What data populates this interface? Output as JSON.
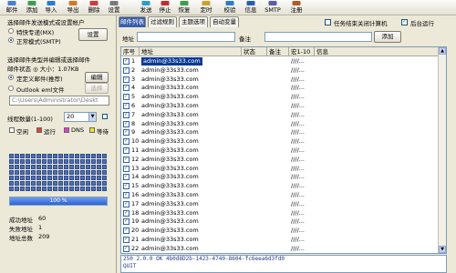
{
  "toolbar": {
    "buttons": [
      {
        "label": "邮件",
        "icon": "mail-icon"
      },
      {
        "label": "添加",
        "icon": "add-icon"
      },
      {
        "label": "导入",
        "icon": "import-icon"
      },
      {
        "label": "导出",
        "icon": "export-icon"
      },
      {
        "label": "删除",
        "icon": "delete-icon"
      },
      {
        "label": "设置",
        "icon": "settings-icon"
      },
      {
        "label": "发送",
        "icon": "send-icon"
      },
      {
        "label": "停止",
        "icon": "stop-icon"
      },
      {
        "label": "恢复",
        "icon": "resume-icon"
      },
      {
        "label": "定时",
        "icon": "timer-icon"
      },
      {
        "label": "校验",
        "icon": "verify-icon"
      },
      {
        "label": "信息",
        "icon": "info-icon"
      },
      {
        "label": "SMTP",
        "icon": "smtp-icon"
      },
      {
        "label": "注册",
        "icon": "register-icon"
      }
    ]
  },
  "left": {
    "send_mode_title": "选择邮件发送模式或设置帐户",
    "mode_special": "特快专递(MX)",
    "mode_smtp": "正常模式(SMTP)",
    "settings_btn": "设置",
    "mail_type_title": "选择邮件类型并编辑或选择邮件",
    "mail_status": "邮件状态 ◎ 大小：1.07KB",
    "type_custom": "定定义邮件(推荐)",
    "edit_btn": "编辑",
    "type_outlook": "Outlook eml文件",
    "choose_btn": "选择",
    "path_value": "C:\\Users\\Administrator\\Deskt",
    "threads_label": "线程数量(1-100)",
    "threads_value": "20",
    "legend": [
      {
        "label": "空闲",
        "color": "#ffffff"
      },
      {
        "label": "运行",
        "color": "#e0443a"
      },
      {
        "label": "DNS",
        "color": "#e040c8"
      },
      {
        "label": "等待",
        "color": "#f0e030"
      }
    ],
    "progress_text": "100 %",
    "progress_fraction": 1.0,
    "stats": {
      "success_label": "成功地址",
      "success_value": "60",
      "fail_label": "失败地址",
      "fail_value": "1",
      "total_label": "地址总数",
      "total_value": "209"
    }
  },
  "tabs": [
    "邮件列表",
    "过滤规则",
    "主题选项",
    "自动变量"
  ],
  "options": {
    "shutdown_label": "任务结束关闭计算机",
    "background_label": "后台运行"
  },
  "address_row": {
    "address_label": "地址",
    "remark_label": "备注",
    "add_btn": "添加"
  },
  "table": {
    "headers": [
      "序号",
      "地址",
      "状态",
      "备注",
      "宏1-10",
      "信息"
    ],
    "rows": [
      {
        "n": "1",
        "addr": "admin@33s33.com",
        "macro": "////..."
      },
      {
        "n": "2",
        "addr": "admin@33s33.com",
        "macro": "////..."
      },
      {
        "n": "3",
        "addr": "admin@33s33.com",
        "macro": "////..."
      },
      {
        "n": "4",
        "addr": "admin@33s33.com",
        "macro": "////..."
      },
      {
        "n": "5",
        "addr": "admin@33s33.com",
        "macro": "////..."
      },
      {
        "n": "6",
        "addr": "admin@33s33.com",
        "macro": "////..."
      },
      {
        "n": "7",
        "addr": "admin@33s33.com",
        "macro": "////..."
      },
      {
        "n": "8",
        "addr": "admin@33s33.com",
        "macro": "////..."
      },
      {
        "n": "9",
        "addr": "admin@33s33.com",
        "macro": "////..."
      },
      {
        "n": "10",
        "addr": "admin@33s33.com",
        "macro": "////..."
      },
      {
        "n": "11",
        "addr": "admin@33s33.com",
        "macro": "////..."
      },
      {
        "n": "12",
        "addr": "admin@33s33.com",
        "macro": "////..."
      },
      {
        "n": "13",
        "addr": "admin@33s33.com",
        "macro": "////..."
      },
      {
        "n": "14",
        "addr": "admin@33s33.com",
        "macro": "////..."
      },
      {
        "n": "15",
        "addr": "admin@33s33.com",
        "macro": "////..."
      },
      {
        "n": "16",
        "addr": "admin@33s33.com",
        "macro": "////..."
      },
      {
        "n": "17",
        "addr": "admin@33s33.com",
        "macro": "////..."
      },
      {
        "n": "18",
        "addr": "admin@33s33.com",
        "macro": "////..."
      },
      {
        "n": "19",
        "addr": "admin@33s33.com",
        "macro": "////..."
      },
      {
        "n": "20",
        "addr": "admin@33s33.com",
        "macro": "////..."
      },
      {
        "n": "21",
        "addr": "admin@33s33.com",
        "macro": "////..."
      },
      {
        "n": "22",
        "addr": "admin@33s33.com",
        "macro": "////..."
      }
    ]
  },
  "log": {
    "lines": [
      "250 2.0.0 OK 4b0d8D2b-1423-4740-8604-fc6eea6d3fd0",
      "QUIT"
    ]
  }
}
